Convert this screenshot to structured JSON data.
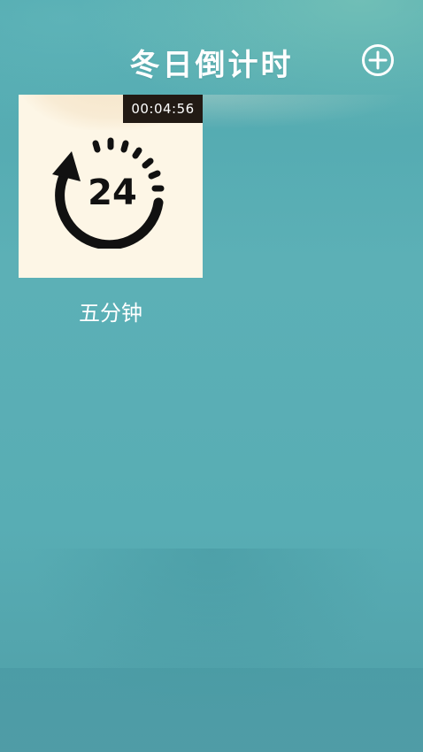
{
  "app": {
    "title": "冬日倒计时"
  },
  "header": {
    "add_icon": "plus-circle-icon"
  },
  "timers": [
    {
      "name": "五分钟",
      "remaining": "00:04:56",
      "icon": "24-hour-countdown-icon",
      "icon_text": "24"
    }
  ],
  "colors": {
    "background": "#58adb4",
    "card_background": "#fdf6e6",
    "badge_background": "#221a14",
    "text": "#ffffff"
  }
}
